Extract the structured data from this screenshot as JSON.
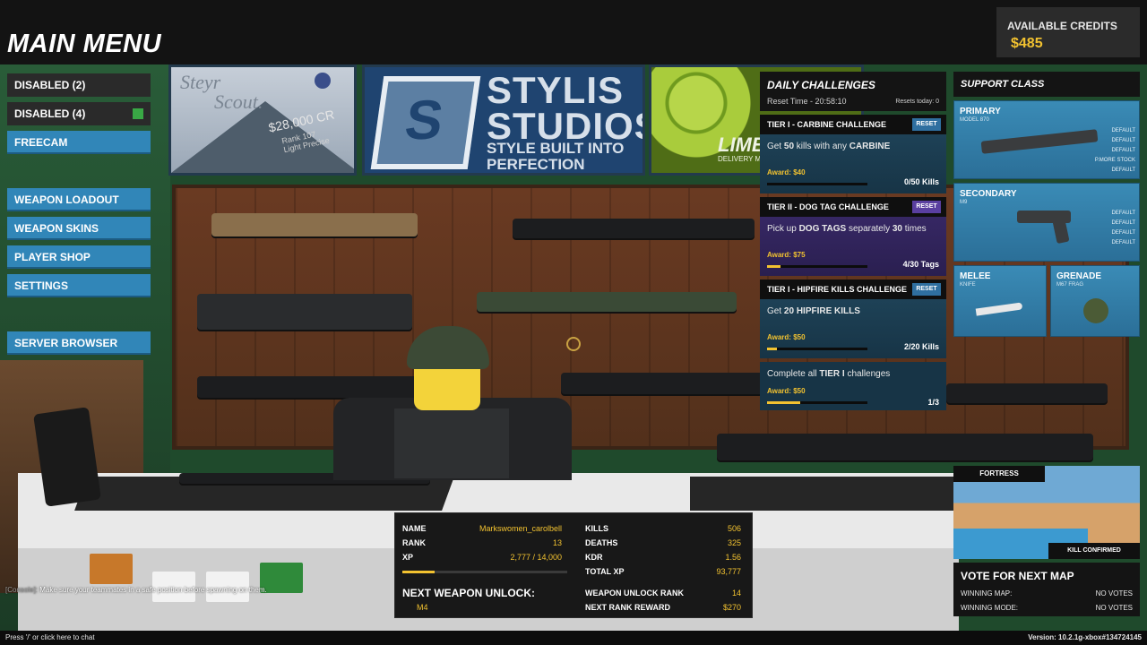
{
  "header": {
    "title": "MAIN MENU"
  },
  "credits": {
    "label": "AVAILABLE CREDITS",
    "value": "$485"
  },
  "menu": {
    "disabled_1": "DISABLED (2)",
    "disabled_2": "DISABLED (4)",
    "freecam": "FREECAM",
    "weapon_loadout": "WEAPON LOADOUT",
    "weapon_skins": "WEAPON SKINS",
    "player_shop": "PLAYER SHOP",
    "settings": "SETTINGS",
    "server_browser": "SERVER BROWSER"
  },
  "banners": {
    "steyr": {
      "line1": "Steyr",
      "line2": "Scout.",
      "price": "$28,000 CR",
      "sub1": "Rank 107",
      "sub2": "Light Precise"
    },
    "stylis": {
      "line1": "STYLIS",
      "line2": "STUDIOS",
      "tag1": "STYLE BUILT INTO",
      "tag2": "PERFECTION"
    },
    "lime": {
      "title": "LIME",
      "sub": "DELIVERY MAN"
    }
  },
  "daily_challenges": {
    "title": "DAILY CHALLENGES",
    "reset_time": "Reset Time - 20:58:10",
    "resets_today": "Resets today: 0",
    "reset_label": "RESET",
    "tiers": [
      {
        "name": "TIER I - CARBINE CHALLENGE",
        "desc_pre": "Get ",
        "desc_bold1": "50",
        "desc_mid": " kills with any ",
        "desc_bold2": "CARBINE",
        "desc_post": "",
        "award": "Award: $40",
        "count": "0/50 Kills",
        "progress": 0.0
      },
      {
        "name": "TIER II - DOG TAG CHALLENGE",
        "desc_pre": "Pick up ",
        "desc_bold1": "DOG TAGS",
        "desc_mid": " separately ",
        "desc_bold2": "30",
        "desc_post": " times",
        "award": "Award: $75",
        "count": "4/30 Tags",
        "progress": 0.133
      },
      {
        "name": "TIER I - HIPFIRE KILLS CHALLENGE",
        "desc_pre": "Get ",
        "desc_bold1": "20",
        "desc_mid": " ",
        "desc_bold2": "HIPFIRE KILLS",
        "desc_post": "",
        "award": "Award: $50",
        "count": "2/20 Kills",
        "progress": 0.1
      }
    ],
    "all": {
      "desc_pre": "Complete all ",
      "desc_bold": "TIER I",
      "desc_post": " challenges",
      "award": "Award: $50",
      "count": "1/3",
      "progress": 0.333
    }
  },
  "support_class": {
    "title": "SUPPORT CLASS",
    "primary": {
      "label": "PRIMARY",
      "sub": "MODEL 870",
      "items": [
        "DEFAULT",
        "DEFAULT",
        "DEFAULT",
        "P.MORE STOCK",
        "DEFAULT"
      ]
    },
    "secondary": {
      "label": "SECONDARY",
      "sub": "M9",
      "items": [
        "DEFAULT",
        "DEFAULT",
        "DEFAULT",
        "DEFAULT"
      ]
    },
    "melee": {
      "label": "MELEE",
      "sub": "KNIFE"
    },
    "grenade": {
      "label": "GRENADE",
      "sub": "M67 FRAG"
    }
  },
  "map_vote": {
    "map_name": "FORTRESS",
    "mode": "KILL CONFIRMED",
    "title": "VOTE FOR NEXT MAP",
    "winning_map_label": "WINNING MAP:",
    "winning_map_value": "NO VOTES",
    "winning_mode_label": "WINNING MODE:",
    "winning_mode_value": "NO VOTES"
  },
  "stats": {
    "name_label": "NAME",
    "name": "Markswomen_carolbell",
    "rank_label": "RANK",
    "rank": "13",
    "xp_label": "XP",
    "xp": "2,777 / 14,000",
    "xp_progress": 0.198,
    "kills_label": "KILLS",
    "kills": "506",
    "deaths_label": "DEATHS",
    "deaths": "325",
    "kdr_label": "KDR",
    "kdr": "1.56",
    "total_xp_label": "TOTAL XP",
    "total_xp": "93,777",
    "next_unlock_label": "NEXT WEAPON UNLOCK:",
    "next_unlock": "M4",
    "unlock_rank_label": "WEAPON UNLOCK RANK",
    "unlock_rank": "14",
    "next_reward_label": "NEXT RANK REWARD",
    "next_reward": "$270"
  },
  "chat": {
    "tag": "[Console]:",
    "message": "Make sure your teammates in a safe position before spawning on them.",
    "hint": "Press '/' or click here to chat"
  },
  "version": "Version: 10.2.1g-xbox#134724145",
  "colors": {
    "accent": "#f2c230",
    "menu_blue": "#3186b8",
    "background": "#131313"
  }
}
